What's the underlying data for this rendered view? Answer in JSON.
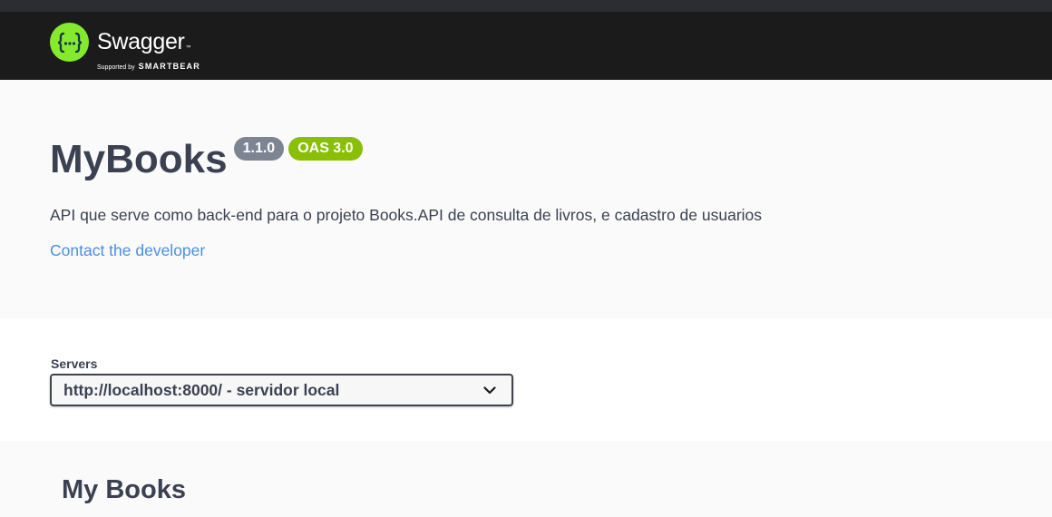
{
  "topbar": {
    "logo": {
      "icon": "swagger-braces-icon",
      "title": "Swagger",
      "tm": "™",
      "subtitle_prefix": "Supported by",
      "subtitle_brand": "SMARTBEAR"
    }
  },
  "info": {
    "title": "MyBooks",
    "version": "1.1.0",
    "oas": "OAS 3.0",
    "description": "API que serve como back-end para o projeto Books.API de consulta de livros, e cadastro de usuarios",
    "contact": "Contact the developer"
  },
  "servers": {
    "label": "Servers",
    "selected": "http://localhost:8000/ - servidor local",
    "dropdown_icon": "chevron-down-icon"
  },
  "tags": [
    {
      "name": "My Books"
    }
  ],
  "colors": {
    "topbar": "#1b1b1b",
    "logo_green": "#85ea2d",
    "version_badge": "#7d8492",
    "oas_badge": "#89bf04",
    "link": "#4990e2",
    "text": "#3b4151"
  }
}
